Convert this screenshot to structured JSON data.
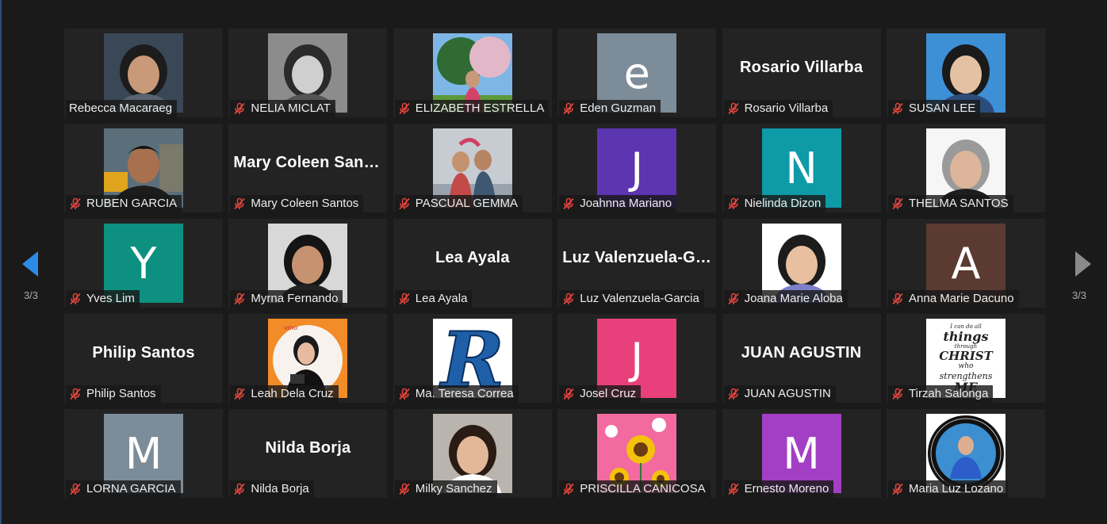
{
  "navigation": {
    "prev_page_label": "3/3",
    "next_page_label": "3/3",
    "accent_left": "#2b8ce6",
    "accent_right": "#8a8a8a"
  },
  "participants": [
    {
      "name": "Rebecca Macaraeg",
      "muted": false,
      "kind": "photo",
      "scene": "woman"
    },
    {
      "name": "NELIA MICLAT",
      "muted": true,
      "kind": "photo",
      "scene": "woman-bw"
    },
    {
      "name": "ELIZABETH ESTRELLA",
      "muted": true,
      "kind": "photo",
      "scene": "tree"
    },
    {
      "name": "Eden Guzman",
      "muted": true,
      "kind": "initial",
      "initial": "e",
      "color": "#7d8c99"
    },
    {
      "name": "Rosario Villarba",
      "muted": true,
      "kind": "text",
      "display": "Rosario Villarba"
    },
    {
      "name": "SUSAN LEE",
      "muted": true,
      "kind": "photo",
      "scene": "woman-blue"
    },
    {
      "name": "RUBEN GARCIA",
      "muted": true,
      "kind": "photo",
      "scene": "man-city"
    },
    {
      "name": "Mary Coleen Santos",
      "muted": true,
      "kind": "text",
      "display": "Mary Coleen Santos"
    },
    {
      "name": "PASCUAL GEMMA",
      "muted": true,
      "kind": "photo",
      "scene": "couple"
    },
    {
      "name": "Joahnna Mariano",
      "muted": true,
      "kind": "initial",
      "initial": "J",
      "color": "#5c35b0"
    },
    {
      "name": "Nielinda Dizon",
      "muted": true,
      "kind": "initial",
      "initial": "N",
      "color": "#0e9aa7"
    },
    {
      "name": "THELMA SANTOS",
      "muted": true,
      "kind": "photo",
      "scene": "woman-white"
    },
    {
      "name": "Yves Lim",
      "muted": true,
      "kind": "initial",
      "initial": "Y",
      "color": "#0e9080"
    },
    {
      "name": "Myrna Fernando",
      "muted": true,
      "kind": "photo",
      "scene": "woman-dark"
    },
    {
      "name": "Lea Ayala",
      "muted": true,
      "kind": "text",
      "display": "Lea Ayala"
    },
    {
      "name": "Luz Valenzuela-Garcia",
      "muted": true,
      "kind": "text",
      "display": "Luz Valenzuela-Garcia"
    },
    {
      "name": "Joana Marie Aloba",
      "muted": true,
      "kind": "photo",
      "scene": "woman-id"
    },
    {
      "name": "Anna Marie Dacuno",
      "muted": true,
      "kind": "initial",
      "initial": "A",
      "color": "#5b3a32"
    },
    {
      "name": "Philip Santos",
      "muted": true,
      "kind": "text",
      "display": "Philip Santos"
    },
    {
      "name": "Leah Dela Cruz",
      "muted": true,
      "kind": "photo",
      "scene": "woman-orange"
    },
    {
      "name": "Ma. Teresa Correa",
      "muted": true,
      "kind": "photo",
      "scene": "letter-r"
    },
    {
      "name": "Josel Cruz",
      "muted": true,
      "kind": "initial",
      "initial": "J",
      "color": "#e8407a"
    },
    {
      "name": "JUAN AGUSTIN",
      "muted": true,
      "kind": "text",
      "display": "JUAN AGUSTIN"
    },
    {
      "name": "Tirzah Salonga",
      "muted": true,
      "kind": "photo",
      "scene": "quote"
    },
    {
      "name": "LORNA GARCIA",
      "muted": true,
      "kind": "initial",
      "initial": "M",
      "color": "#7d8c99"
    },
    {
      "name": "Nilda Borja",
      "muted": true,
      "kind": "text",
      "display": "Nilda Borja"
    },
    {
      "name": "Milky Sanchez",
      "muted": true,
      "kind": "photo",
      "scene": "woman-young"
    },
    {
      "name": "PRISCILLA CANICOSA",
      "muted": true,
      "kind": "photo",
      "scene": "sunflower"
    },
    {
      "name": "Ernesto Moreno",
      "muted": true,
      "kind": "initial",
      "initial": "M",
      "color": "#a33fc4"
    },
    {
      "name": "Maria Luz Lozano",
      "muted": true,
      "kind": "photo",
      "scene": "badge"
    }
  ],
  "quote_lines": [
    "I can do all",
    "things",
    "through",
    "CHRIST",
    "who",
    "strengthens",
    "ME"
  ]
}
